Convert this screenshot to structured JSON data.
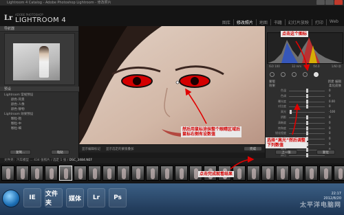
{
  "window": {
    "title": "Lightroom 4 Catalog - Adobe Photoshop Lightroom - 修改照片"
  },
  "identity": {
    "logo": "Lr",
    "sub": "ADOBE PHOTOSHOP",
    "product": "LIGHTROOM 4"
  },
  "modules": [
    "图库",
    "修改照片",
    "地图",
    "书籍",
    "幻灯片放映",
    "打印",
    "Web"
  ],
  "active_module": "修改照片",
  "left_panel": {
    "navigator_label": "导航器",
    "presets_label": "预设",
    "preset_items": [
      "Lightroom 常规预设",
      "颜色-风景",
      "颜色-人像",
      "颜色-静物",
      "Lightroom 效果预设",
      "颗粒-粗",
      "颗粒-中",
      "颗粒-细"
    ],
    "copy_button": "复制...",
    "paste_button": "粘贴"
  },
  "center_toolbar": {
    "show_label": "显示编辑标记",
    "auto_label": "显示选定的蒙版叠加",
    "done_button": "完成"
  },
  "right_panel": {
    "histogram_info": [
      "ISO 100",
      "32 mm",
      "f/4.0",
      "1/60 秒"
    ],
    "tool_names": [
      "crop-tool",
      "spot-removal-tool",
      "red-eye-tool",
      "graduated-filter-tool",
      "adjustment-brush-tool"
    ],
    "selected_tool": "adjustment-brush-tool",
    "header_left": "蒙版",
    "header_right": "新建   编辑",
    "effect_label": "效果",
    "effect_preset": "柔化皮肤",
    "sliders": [
      {
        "label": "色温",
        "value": "0"
      },
      {
        "label": "色调",
        "value": "0"
      },
      {
        "label": "曝光度",
        "value": "0.00"
      },
      {
        "label": "对比度",
        "value": "0"
      },
      {
        "label": "高光",
        "value": "-100"
      },
      {
        "label": "阴影",
        "value": "0"
      },
      {
        "label": "清晰度",
        "value": "0"
      },
      {
        "label": "饱和度",
        "value": "0"
      },
      {
        "label": "锐化程度",
        "value": "0"
      },
      {
        "label": "杂色",
        "value": "0"
      },
      {
        "label": "波纹",
        "value": "0"
      },
      {
        "label": "去边",
        "value": "0"
      },
      {
        "label": "颜色",
        "value": ""
      }
    ],
    "slider_positions": [
      0.5,
      0.5,
      0.5,
      0.5,
      0.05,
      0.5,
      0.5,
      0.5,
      0.5,
      0.5,
      0.5,
      0.5,
      0.5
    ],
    "prev_button": "上一张",
    "reset_button": "复位"
  },
  "filmstrip": {
    "bar_text": "文件夹：汽车模型 ...  434 张照片 / 选定 1 张 /",
    "file_name": "DSC_3484.NEF",
    "thumb_count": 24,
    "selected_index": 4
  },
  "taskbar": {
    "apps": [
      "IE",
      "文件夹",
      "媒体",
      "Lr",
      "Ps"
    ],
    "time": "22:17",
    "date": "2012/8/20"
  },
  "watermark": "太平洋电脑网",
  "annotations": {
    "top_right": "点击这个图标",
    "middle": "然后用鼠标涂抹整个眼睛区域后\n鼠标右侧有设数值",
    "right": "选择“高光”然后调整\n下列数值",
    "bottom": "点击完成就看结果"
  }
}
